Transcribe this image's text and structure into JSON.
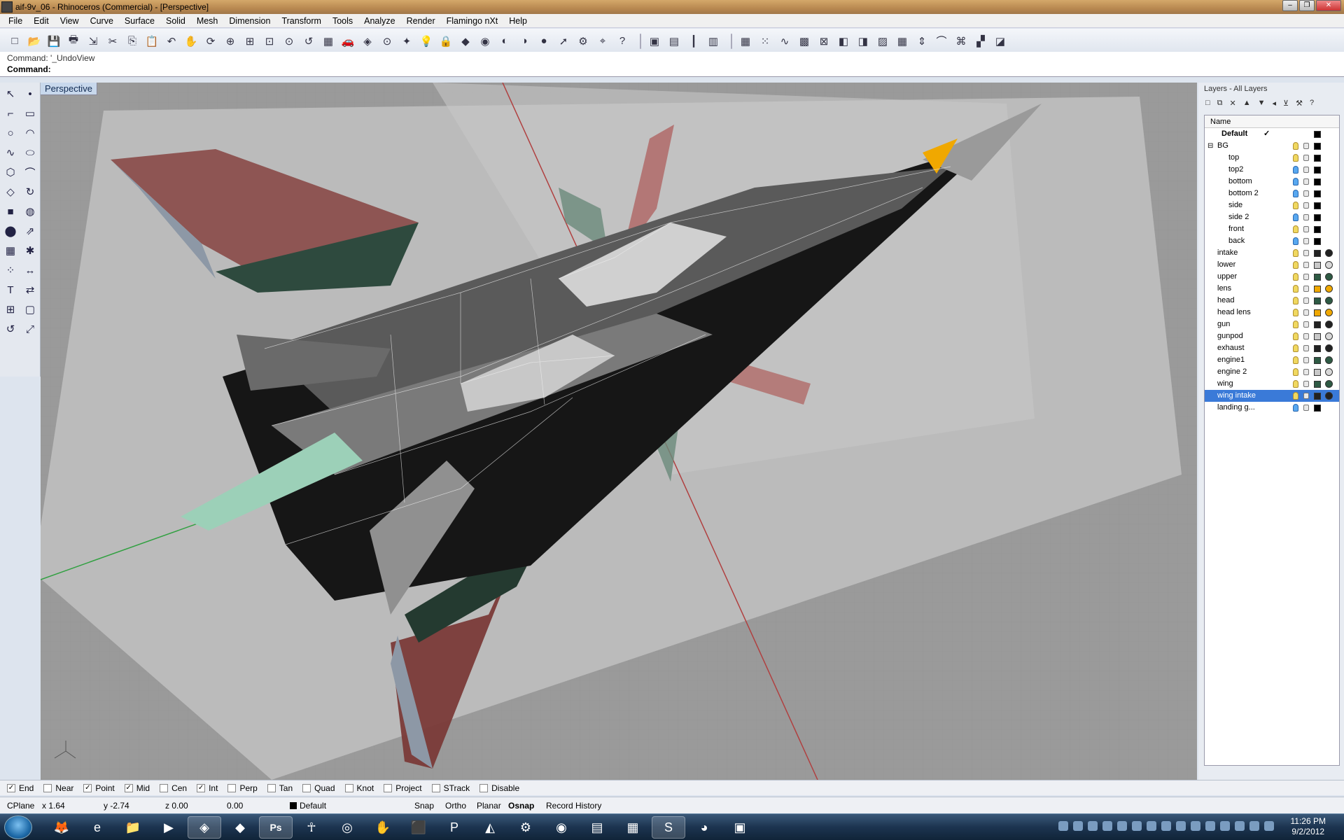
{
  "window": {
    "title": "aif-9v_06 - Rhinoceros (Commercial) - [Perspective]"
  },
  "menu": [
    "File",
    "Edit",
    "View",
    "Curve",
    "Surface",
    "Solid",
    "Mesh",
    "Dimension",
    "Transform",
    "Tools",
    "Analyze",
    "Render",
    "Flamingo nXt",
    "Help"
  ],
  "toolbar_icons": [
    "new-icon",
    "open-icon",
    "save-icon",
    "print-icon",
    "import-icon",
    "cut-icon",
    "copy-icon",
    "paste-icon",
    "undo-icon",
    "pan-icon",
    "rotate-view-icon",
    "zoom-dynamic-icon",
    "zoom-window-icon",
    "zoom-extents-icon",
    "zoom-selected-icon",
    "undo-view-icon",
    "four-viewports-icon",
    "render-car-icon",
    "mesh-render-icon",
    "select-icon",
    "grid-snap-icon",
    "light-icon",
    "lock-icon",
    "material-icon",
    "color-wheel-icon",
    "shaded-sphere-icon",
    "ghosted-sphere-icon",
    "rendered-sphere-icon",
    "flamingo-icon",
    "gear-icon",
    "dimension-icon",
    "help-icon",
    "box-icon",
    "viewport-icon",
    "divider-icon",
    "cplane-icon",
    "array-icon",
    "points-icon",
    "curve-tools-icon",
    "grid-icon",
    "history-icon",
    "surface-tools-icon",
    "solid-tools-icon",
    "mesh-tools-icon",
    "drafting-icon",
    "transform-icon",
    "analyze-icon",
    "curvature-icon",
    "zebra-icon",
    "render-tools-icon"
  ],
  "command": {
    "history": "Command: '_UndoView",
    "prompt": "Command:"
  },
  "left_tools": [
    "select-arrow-icon",
    "point-icon",
    "polyline-icon",
    "rectangle-icon",
    "circle-icon",
    "arc-icon",
    "curve-icon",
    "ellipse-icon",
    "polygon-icon",
    "fillet-icon",
    "surface-icon",
    "revolve-icon",
    "box-solid-icon",
    "boolean-icon",
    "cylinder-icon",
    "extrude-icon",
    "mesh-icon",
    "explode-icon",
    "edit-points-icon",
    "dimension-icon",
    "text-icon",
    "transform-icon",
    "array-icon",
    "block-icon",
    "rotate-icon",
    "scale-icon"
  ],
  "viewport": {
    "label": "Perspective"
  },
  "layers_panel": {
    "header": "Layers - All Layers",
    "column_name": "Name",
    "tools": [
      "new-layer-icon",
      "new-sublayer-icon",
      "delete-icon",
      "move-up-icon",
      "move-down-icon",
      "parent-icon",
      "filter-icon",
      "tools-icon",
      "help-icon"
    ],
    "layers": [
      {
        "name": "Default",
        "current": "✓",
        "bulb": "",
        "color": "#000000",
        "material": "",
        "indent": 0,
        "bold": true
      },
      {
        "name": "BG",
        "expander": "⊟",
        "bulb": "yellow",
        "color": "#000000",
        "material": "",
        "indent": 0
      },
      {
        "name": "top",
        "bulb": "yellow",
        "color": "#000000",
        "material": "",
        "indent": 1
      },
      {
        "name": "top2",
        "bulb": "blue",
        "color": "#000000",
        "material": "",
        "indent": 1
      },
      {
        "name": "bottom",
        "bulb": "blue",
        "color": "#000000",
        "material": "",
        "indent": 1
      },
      {
        "name": "bottom 2",
        "bulb": "blue",
        "color": "#000000",
        "material": "",
        "indent": 1
      },
      {
        "name": "side",
        "bulb": "yellow",
        "color": "#000000",
        "material": "",
        "indent": 1
      },
      {
        "name": "side 2",
        "bulb": "blue",
        "color": "#000000",
        "material": "",
        "indent": 1
      },
      {
        "name": "front",
        "bulb": "yellow",
        "color": "#000000",
        "material": "",
        "indent": 1
      },
      {
        "name": "back",
        "bulb": "blue",
        "color": "#000000",
        "material": "",
        "indent": 1
      },
      {
        "name": "intake",
        "bulb": "yellow",
        "color": "#222222",
        "material": "#222222",
        "indent": 0
      },
      {
        "name": "lower",
        "bulb": "yellow",
        "color": "#c8c8c8",
        "material": "#d8d8d8",
        "indent": 0
      },
      {
        "name": "upper",
        "bulb": "yellow",
        "color": "#2e5a44",
        "material": "#2e5a44",
        "indent": 0
      },
      {
        "name": "lens",
        "bulb": "yellow",
        "color": "#f0a800",
        "material": "#f0a800",
        "indent": 0
      },
      {
        "name": "head",
        "bulb": "yellow",
        "color": "#2e5a44",
        "material": "#2e5a44",
        "indent": 0
      },
      {
        "name": "head lens",
        "bulb": "yellow",
        "color": "#f0a800",
        "material": "#f0a800",
        "indent": 0
      },
      {
        "name": "gun",
        "bulb": "yellow",
        "color": "#222222",
        "material": "#222222",
        "indent": 0
      },
      {
        "name": "gunpod",
        "bulb": "yellow",
        "color": "#c8c8c8",
        "material": "#d8d8d8",
        "indent": 0
      },
      {
        "name": "exhaust",
        "bulb": "yellow",
        "color": "#222222",
        "material": "#222222",
        "indent": 0
      },
      {
        "name": "engine1",
        "bulb": "yellow",
        "color": "#2e5a44",
        "material": "#2e5a44",
        "indent": 0
      },
      {
        "name": "engine 2",
        "bulb": "yellow",
        "color": "#c8c8c8",
        "material": "#d8d8d8",
        "indent": 0
      },
      {
        "name": "wing",
        "bulb": "yellow",
        "color": "#2e5a44",
        "material": "#2e5a44",
        "indent": 0
      },
      {
        "name": "wing intake",
        "bulb": "yellow",
        "color": "#222222",
        "material": "#222222",
        "indent": 0,
        "selected": true
      },
      {
        "name": "landing g...",
        "bulb": "blue",
        "color": "#000000",
        "material": "",
        "indent": 0
      }
    ]
  },
  "osnaps": [
    {
      "label": "End",
      "checked": true
    },
    {
      "label": "Near",
      "checked": false
    },
    {
      "label": "Point",
      "checked": true
    },
    {
      "label": "Mid",
      "checked": true
    },
    {
      "label": "Cen",
      "checked": false
    },
    {
      "label": "Int",
      "checked": true
    },
    {
      "label": "Perp",
      "checked": false
    },
    {
      "label": "Tan",
      "checked": false
    },
    {
      "label": "Quad",
      "checked": false
    },
    {
      "label": "Knot",
      "checked": false
    },
    {
      "label": "Project",
      "checked": false
    },
    {
      "label": "STrack",
      "checked": false
    },
    {
      "label": "Disable",
      "checked": false
    }
  ],
  "status": {
    "cplane": "CPlane",
    "x": "x 1.64",
    "y": "y -2.74",
    "z": "z 0.00",
    "dist": "0.00",
    "layer": "Default",
    "snap": "Snap",
    "ortho": "Ortho",
    "planar": "Planar",
    "osnap": "Osnap",
    "history": "Record History"
  },
  "taskbar": {
    "apps": [
      "firefox-icon",
      "internet-explorer-icon",
      "explorer-folder-icon",
      "media-player-icon",
      "rhino-icon",
      "sketchup-icon",
      "photoshop-icon",
      "zbrush-icon",
      "blender-icon",
      "hand-icon",
      "adobe-icon",
      "powerpoint-icon",
      "unity-icon",
      "maya-icon",
      "dreamweaver-icon",
      "notepad-icon",
      "calculator-icon",
      "skype-icon",
      "media-icon",
      "folder-tool-icon"
    ],
    "photoshop_label": "Ps",
    "time": "11:26 PM",
    "date": "9/2/2012"
  }
}
